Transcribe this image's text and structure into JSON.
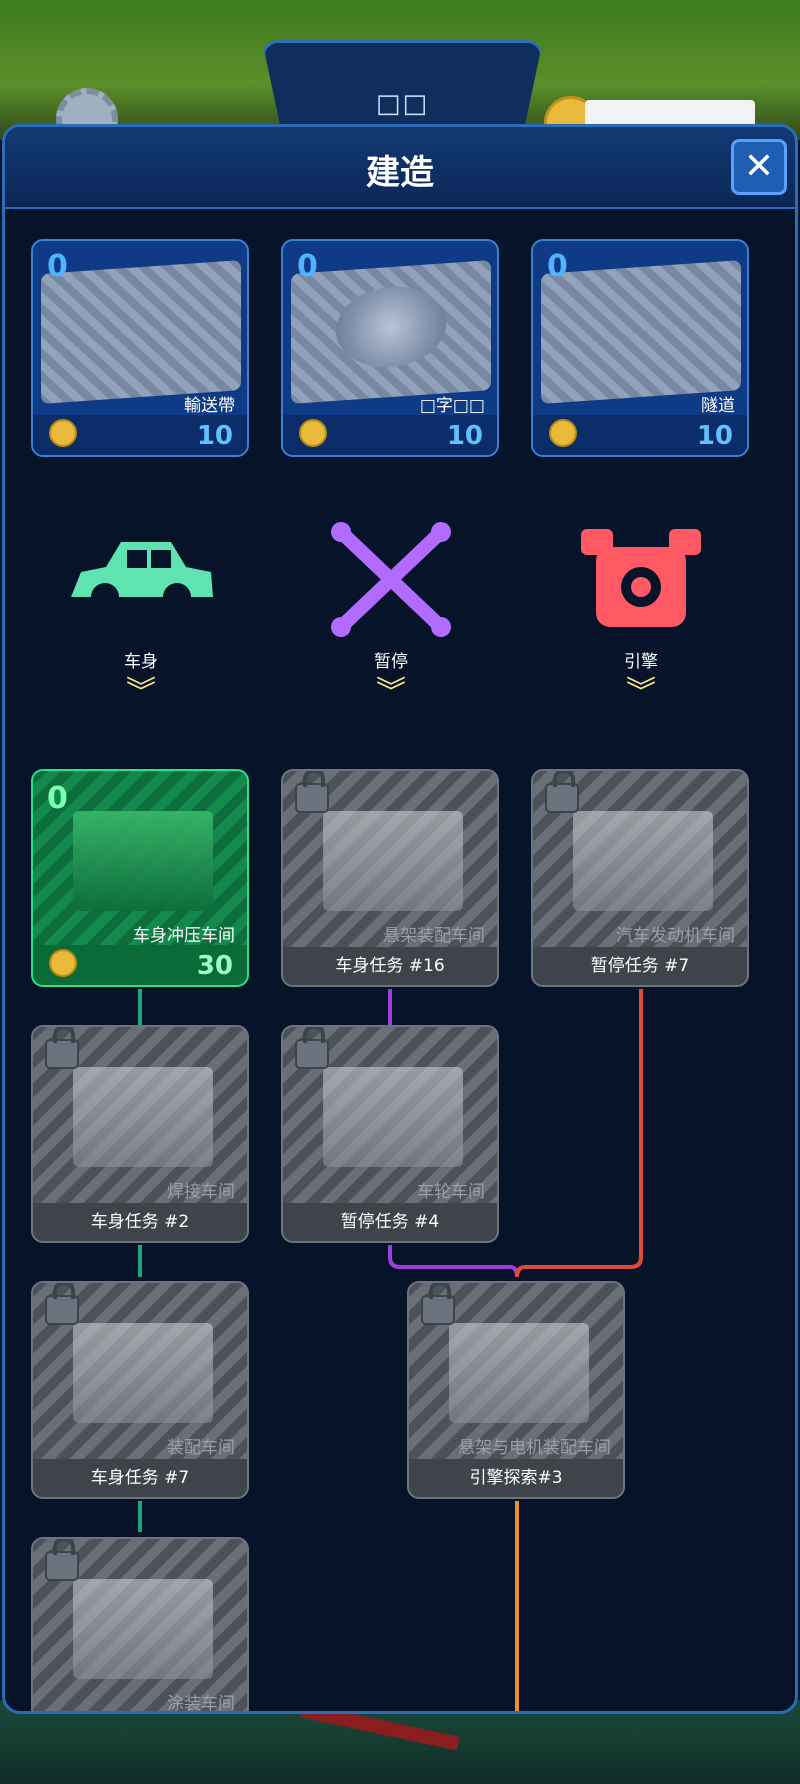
{
  "top_tab": {
    "title": "□□"
  },
  "panel": {
    "title": "建造",
    "close_label": "✕"
  },
  "basic_items": [
    {
      "count": "0",
      "name": "輸送帶",
      "price": "10"
    },
    {
      "count": "0",
      "name": "□字□□",
      "price": "10"
    },
    {
      "count": "0",
      "name": "隧道",
      "price": "10"
    }
  ],
  "categories": [
    {
      "label": "车身",
      "icon": "car-body-icon",
      "color": "#5fe3b0",
      "arrow": "︾"
    },
    {
      "label": "暂停",
      "icon": "suspension-icon",
      "color": "#b36bff",
      "arrow": "︾"
    },
    {
      "label": "引擎",
      "icon": "engine-icon",
      "color": "#ff5a63",
      "arrow": "︾"
    }
  ],
  "buildings": {
    "row1": [
      {
        "name": "车身冲压车间",
        "count": "0",
        "price": "30",
        "locked": false
      },
      {
        "name": "悬架装配车间",
        "requirement": "车身任务 #16",
        "locked": true
      },
      {
        "name": "汽车发动机车间",
        "requirement": "暂停任务 #7",
        "locked": true
      }
    ],
    "row2": [
      {
        "name": "焊接车间",
        "requirement": "车身任务 #2",
        "locked": true
      },
      {
        "name": "车轮车间",
        "requirement": "暂停任务 #4",
        "locked": true
      }
    ],
    "row3": [
      {
        "name": "装配车间",
        "requirement": "车身任务 #7",
        "locked": true
      },
      {
        "name": "悬架与电机装配车间",
        "requirement": "引擎探索#3",
        "locked": true
      }
    ],
    "row4": [
      {
        "name": "涂装车间",
        "locked": true
      }
    ]
  },
  "colors": {
    "body_line": "#1ea37a",
    "suspension_line": "#a23be0",
    "engine_line": "#e04a3a",
    "merge_line": "#e89030"
  }
}
